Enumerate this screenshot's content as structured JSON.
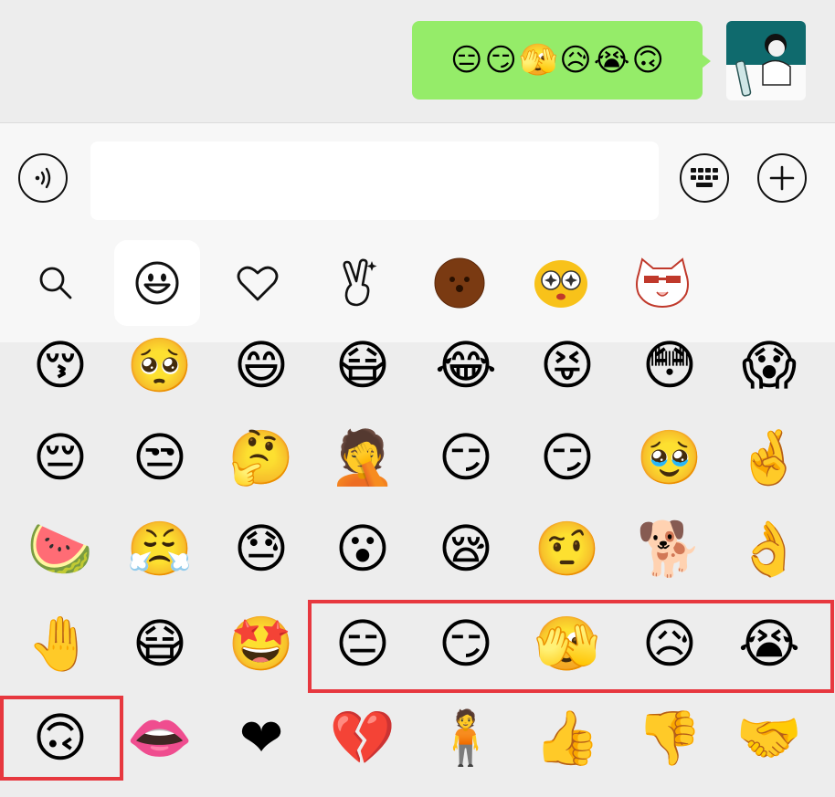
{
  "sent_message": {
    "emojis": [
      "😑",
      "😏",
      "🫣",
      "😥",
      "😭",
      "🙃"
    ]
  },
  "input_bar": {
    "voice_icon": "voice-icon",
    "keyboard_icon": "keyboard-icon",
    "plus_icon": "plus-icon",
    "text_value": ""
  },
  "emoji_tabs": [
    {
      "name": "search",
      "icon": "search-icon"
    },
    {
      "name": "emoji",
      "icon": "smiley-icon",
      "active": true
    },
    {
      "name": "favorites",
      "icon": "heart-icon"
    },
    {
      "name": "gestures",
      "icon": "victory-hand-icon"
    },
    {
      "name": "sticker-brown",
      "glyph": "🟤"
    },
    {
      "name": "sticker-star-eyes",
      "glyph": "🤩"
    },
    {
      "name": "sticker-cat",
      "glyph": "🐱"
    }
  ],
  "emoji_grid": [
    [
      "😚",
      "🥺",
      "😄",
      "😷",
      "😂",
      "😝",
      "😳",
      "😱"
    ],
    [
      "😔",
      "😒",
      "🤔",
      "🤦",
      "😏",
      "😏",
      "🥹",
      "🤞"
    ],
    [
      "🍉",
      "😤",
      "😓",
      "😮",
      "😪",
      "🤨",
      "🐕",
      "👌"
    ],
    [
      "🤚",
      "😷",
      "🤩",
      "😑",
      "😏",
      "🫣",
      "😥",
      "😭"
    ],
    [
      "🙃",
      "👄",
      "❤",
      "💔",
      "🧍",
      "👍",
      "👎",
      "🤝"
    ]
  ],
  "highlight_color": "#e7383f"
}
